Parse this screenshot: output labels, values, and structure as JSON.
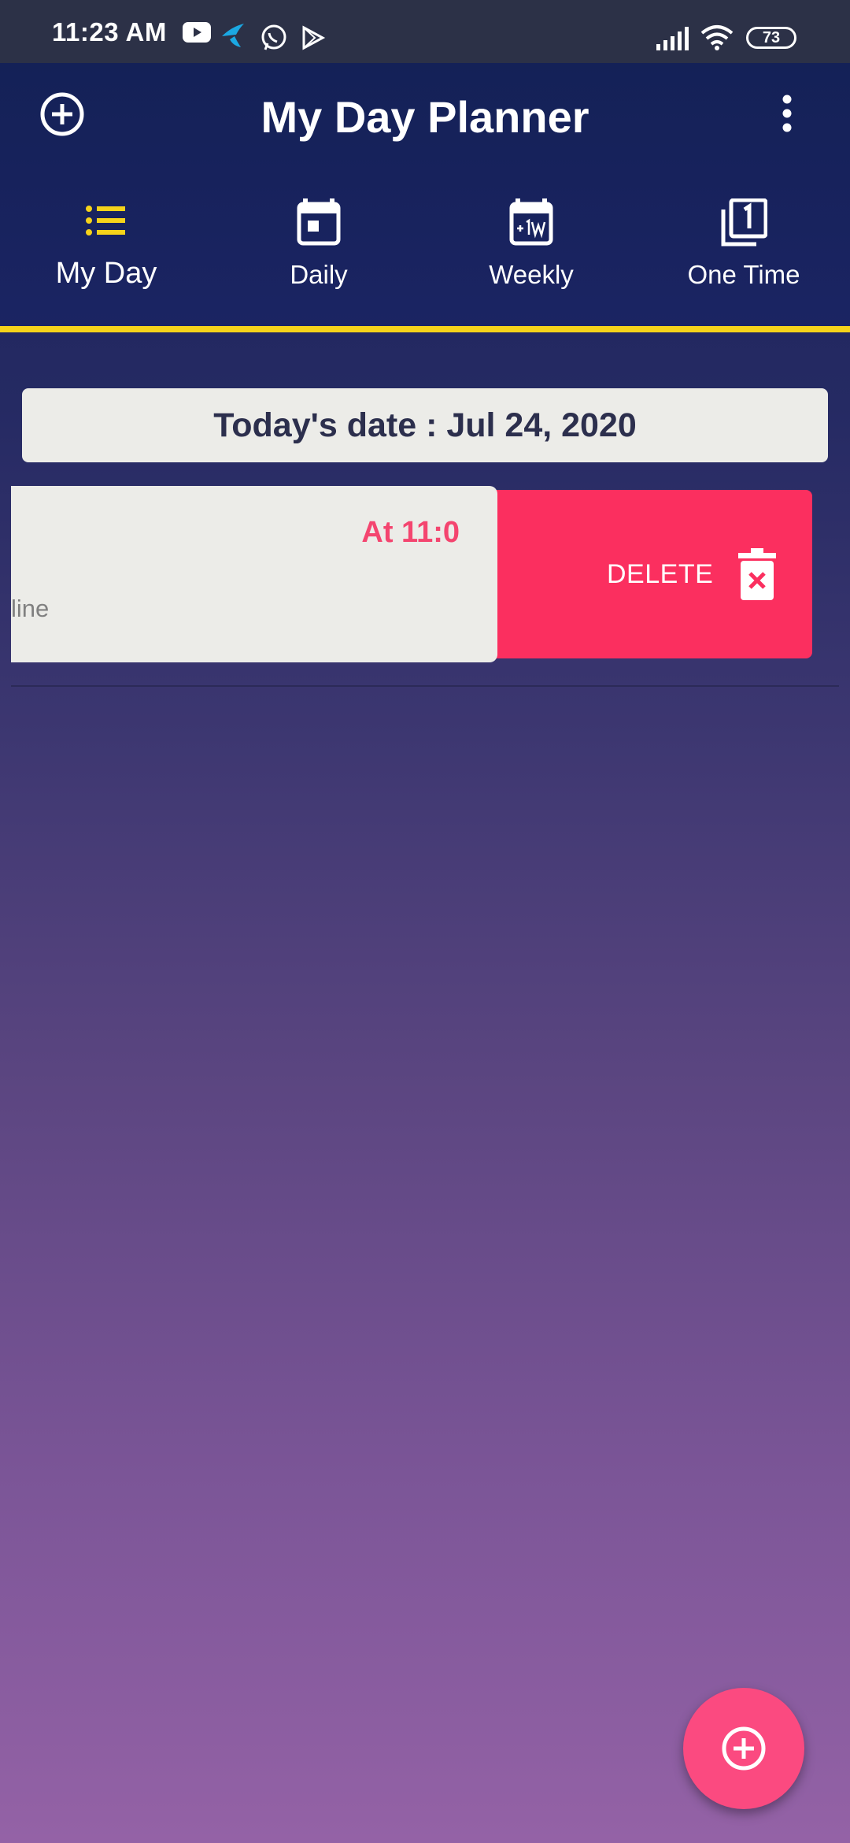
{
  "status_bar": {
    "time": "11:23 AM",
    "battery": "73",
    "icons": [
      "youtube-icon",
      "telenor-icon",
      "whatsapp-icon",
      "play-store-icon",
      "signal-icon",
      "wifi-icon"
    ]
  },
  "header": {
    "title": "My Day Planner",
    "add_icon": "add-circle-icon",
    "menu_icon": "more-vert-icon"
  },
  "tabs": [
    {
      "label": "My Day",
      "icon": "list-icon",
      "active": true
    },
    {
      "label": "Daily",
      "icon": "calendar-today-icon",
      "active": false
    },
    {
      "label": "Weekly",
      "icon": "calendar-plus-1w-icon",
      "active": false
    },
    {
      "label": "One Time",
      "icon": "filter-1-icon",
      "active": false
    }
  ],
  "date_banner": "Today's date : Jul 24, 2020",
  "task": {
    "time": "At 11:0",
    "subtitle": "line"
  },
  "swipe_action": {
    "label": "DELETE",
    "icon": "delete-icon"
  },
  "fab": {
    "icon": "add-circle-icon"
  },
  "colors": {
    "tab_indicator": "#f6d31a",
    "delete": "#fb2f5f",
    "fab": "#fb4a80",
    "task_time": "#f4456f",
    "app_bar": "#142157"
  }
}
